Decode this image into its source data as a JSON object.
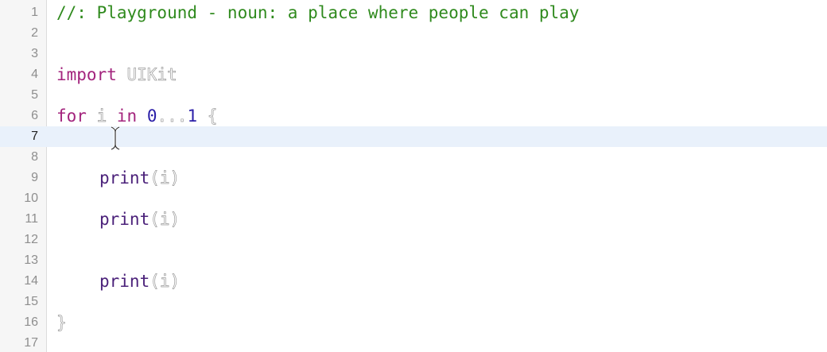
{
  "gutter": {
    "line_numbers": [
      "1",
      "2",
      "3",
      "4",
      "5",
      "6",
      "7",
      "8",
      "9",
      "10",
      "11",
      "12",
      "13",
      "14",
      "15",
      "16",
      "17"
    ],
    "current_line": "7"
  },
  "code": {
    "line1": {
      "comment": "//: Playground - noun: a place where people can play"
    },
    "line4": {
      "keyword": "import",
      "module": "UIKit"
    },
    "line6": {
      "keyword_for": "for",
      "loop_var": "i",
      "keyword_in": "in",
      "range_start": "0",
      "range_op": "...",
      "range_end": "1",
      "open_brace": "{"
    },
    "line9": {
      "func": "print",
      "args": "(i)"
    },
    "line11": {
      "func": "print",
      "args": "(i)"
    },
    "line14": {
      "func": "print",
      "args": "(i)"
    },
    "line16": {
      "close_brace": "}"
    }
  },
  "colors": {
    "comment": "#2f8a1d",
    "keyword": "#a3247d",
    "number": "#2b1fa8",
    "function": "#4b217a",
    "current_line_highlight": "#e9f1fb",
    "gutter_background": "#f6f6f6"
  },
  "cursor": {
    "icon": "text-cursor-ibeam-icon"
  }
}
